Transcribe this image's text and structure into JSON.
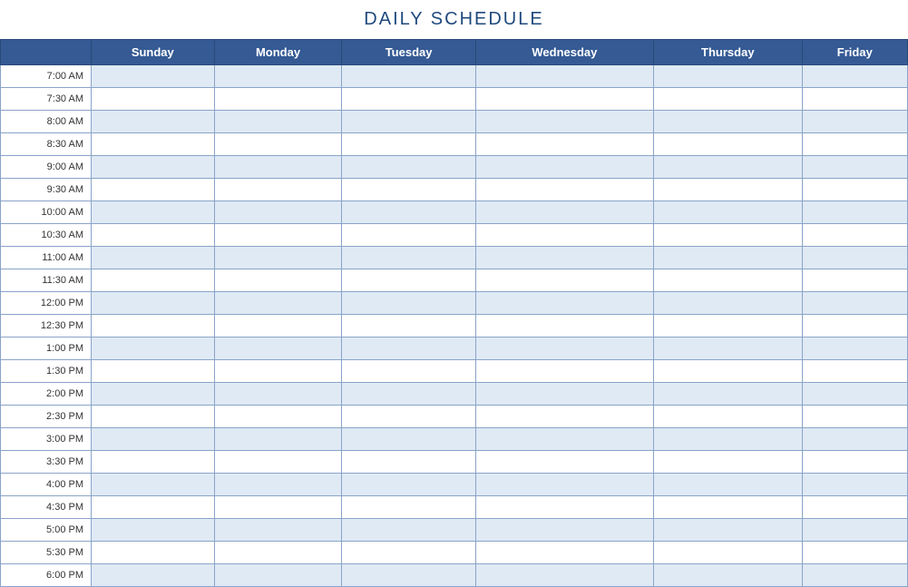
{
  "title": "DAILY SCHEDULE",
  "days": [
    "Sunday",
    "Monday",
    "Tuesday",
    "Wednesday",
    "Thursday",
    "Friday"
  ],
  "time_slots": [
    "7:00 AM",
    "7:30 AM",
    "8:00 AM",
    "8:30 AM",
    "9:00 AM",
    "9:30 AM",
    "10:00 AM",
    "10:30 AM",
    "11:00 AM",
    "11:30 AM",
    "12:00 PM",
    "12:30 PM",
    "1:00 PM",
    "1:30 PM",
    "2:00 PM",
    "2:30 PM",
    "3:00 PM",
    "3:30 PM",
    "4:00 PM",
    "4:30 PM",
    "5:00 PM",
    "5:30 PM",
    "6:00 PM"
  ]
}
